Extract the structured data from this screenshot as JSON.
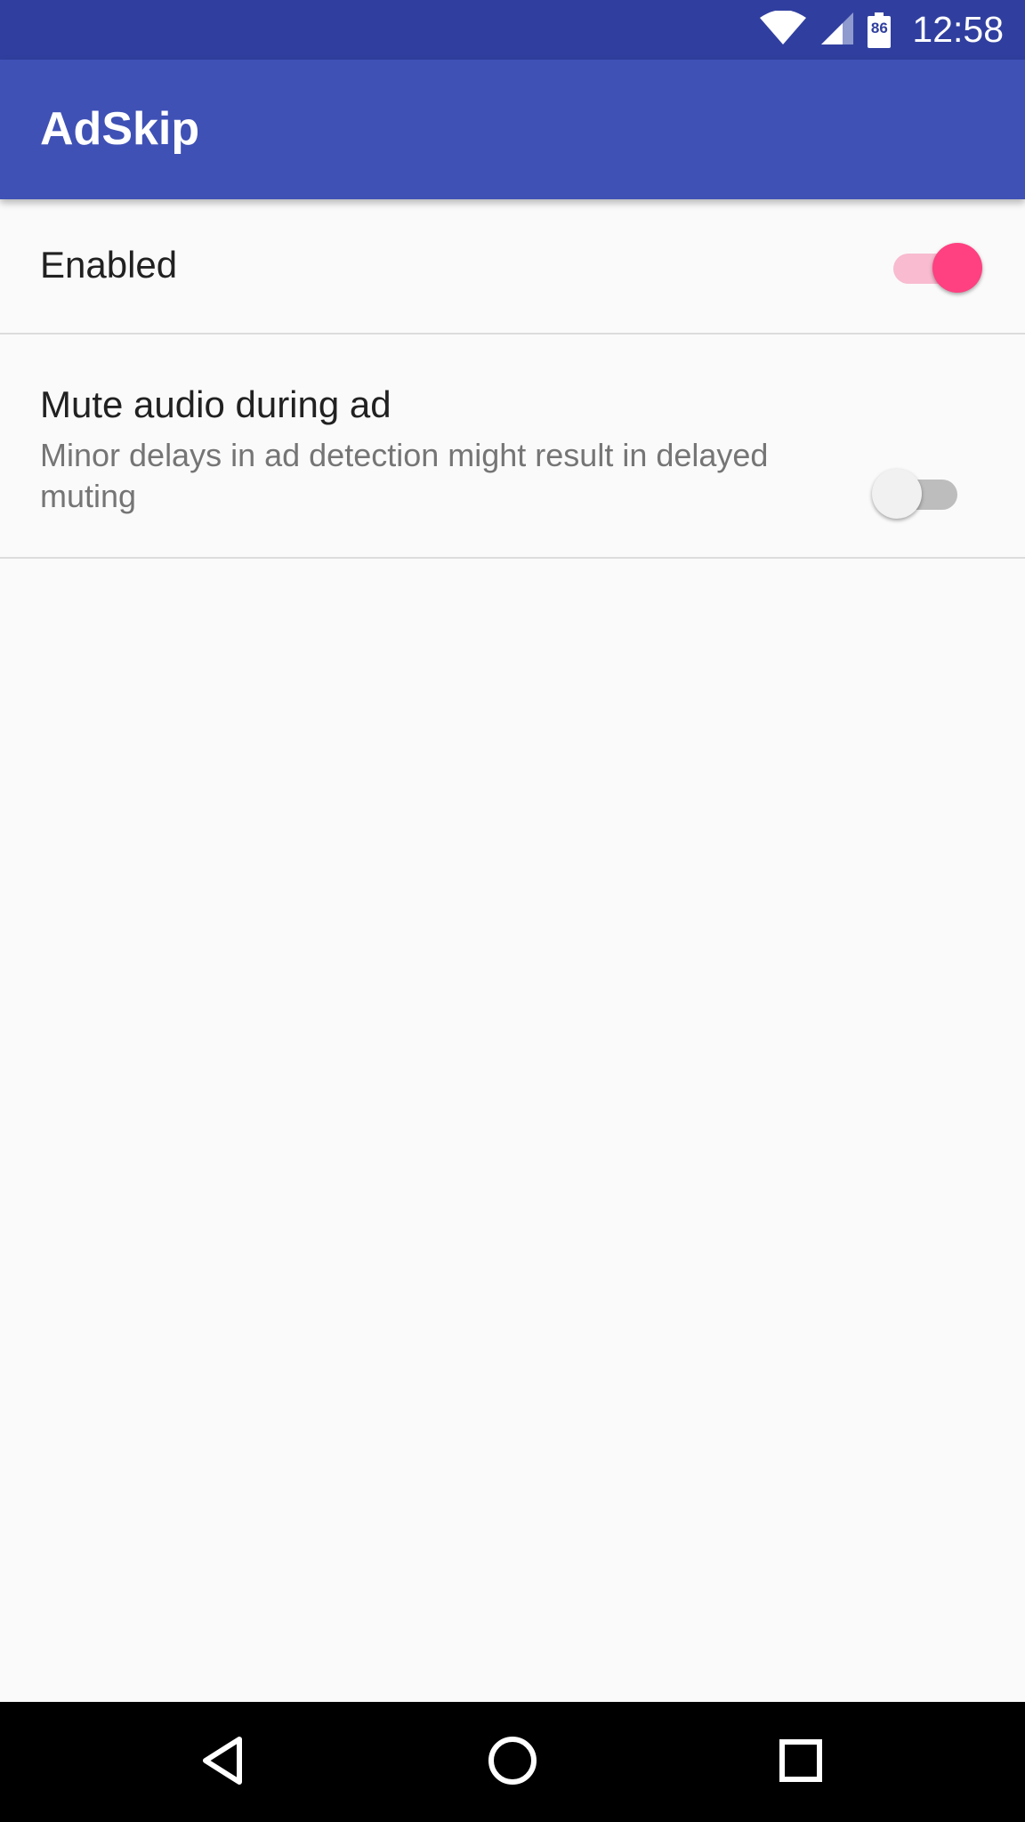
{
  "status_bar": {
    "time": "12:58",
    "battery_level": "86",
    "icons": [
      "wifi-icon",
      "cell-signal-icon",
      "battery-icon"
    ]
  },
  "app_bar": {
    "title": "AdSkip"
  },
  "settings": [
    {
      "title": "Enabled",
      "summary": "",
      "checked": true
    },
    {
      "title": "Mute audio during ad",
      "summary": "Minor delays in ad detection might result in delayed muting",
      "checked": false
    }
  ],
  "nav_bar": {
    "buttons": [
      "back-icon",
      "home-icon",
      "recents-icon"
    ]
  },
  "colors": {
    "status_bar": "#303f9f",
    "app_bar": "#3f51b5",
    "accent": "#ff4081",
    "accent_track": "#f8bbd0",
    "switch_off_thumb": "#f1f1f1",
    "switch_off_track": "#bdbdbd",
    "background": "#fafafa",
    "divider": "#dcdcdc"
  }
}
